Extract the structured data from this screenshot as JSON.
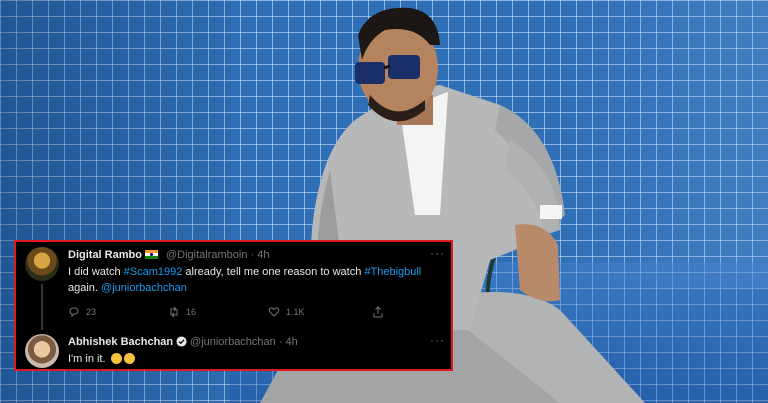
{
  "colors": {
    "card_bg": "#000000",
    "card_border": "#e0191f",
    "link": "#1d9bf0",
    "muted": "#71767b",
    "text": "#e7e9ea",
    "tile_blue": "#2f6fb5"
  },
  "tweet1": {
    "name": "Digital Rambo",
    "handle": "@Digitalramboin · 4h",
    "text_parts": [
      "I did watch ",
      "#Scam1992",
      " already, tell me one reason to watch ",
      "#Thebigbull",
      " again. ",
      "@juniorbachchan"
    ],
    "actions": {
      "reply": "23",
      "retweet": "16",
      "like": "1.1K"
    },
    "icons": [
      "india-flag-icon",
      "more-icon",
      "reply-icon",
      "retweet-icon",
      "like-icon",
      "share-icon"
    ]
  },
  "tweet2": {
    "name": "Abhishek Bachchan",
    "handle": "@juniorbachchan · 4h",
    "text": "I'm in it.",
    "icons": [
      "verified-icon",
      "wink-emoji-icon",
      "laughing-emoji-icon",
      "more-icon"
    ]
  },
  "more_glyph": "···"
}
